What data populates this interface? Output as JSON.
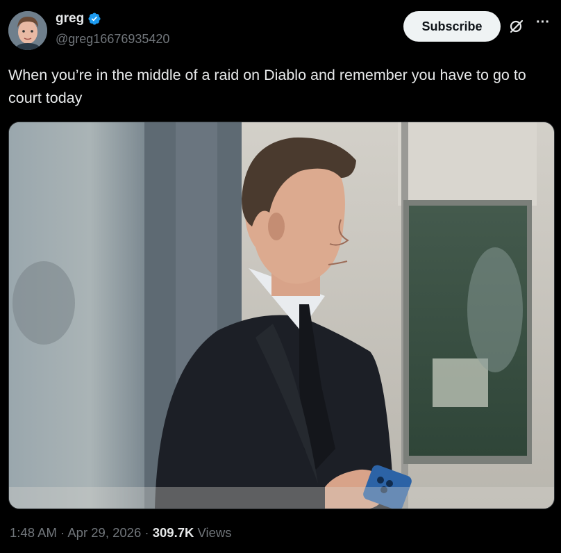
{
  "author": {
    "display_name": "greg",
    "handle": "@greg16676935420",
    "avatar_icon": "person-avatar",
    "verified_icon": "verified-badge-icon",
    "verified_color": "#1d9bf0"
  },
  "actions": {
    "subscribe_label": "Subscribe",
    "grok_icon": "grok-icon",
    "more_icon": "more-icon",
    "more_glyph": "···"
  },
  "tweet": {
    "text": "When you’re in the middle of a raid on Diablo and remember you have to go to court today"
  },
  "media": {
    "type": "photo"
  },
  "meta": {
    "time": "1:48 AM",
    "sep1": " · ",
    "date": "Apr 29, 2026",
    "sep2": " · ",
    "views_count": "309.7K",
    "views_label": " Views"
  },
  "colors": {
    "background": "#000000",
    "text_primary": "#e7e9ea",
    "text_secondary": "#71767b",
    "button_bg": "#eff3f4"
  }
}
